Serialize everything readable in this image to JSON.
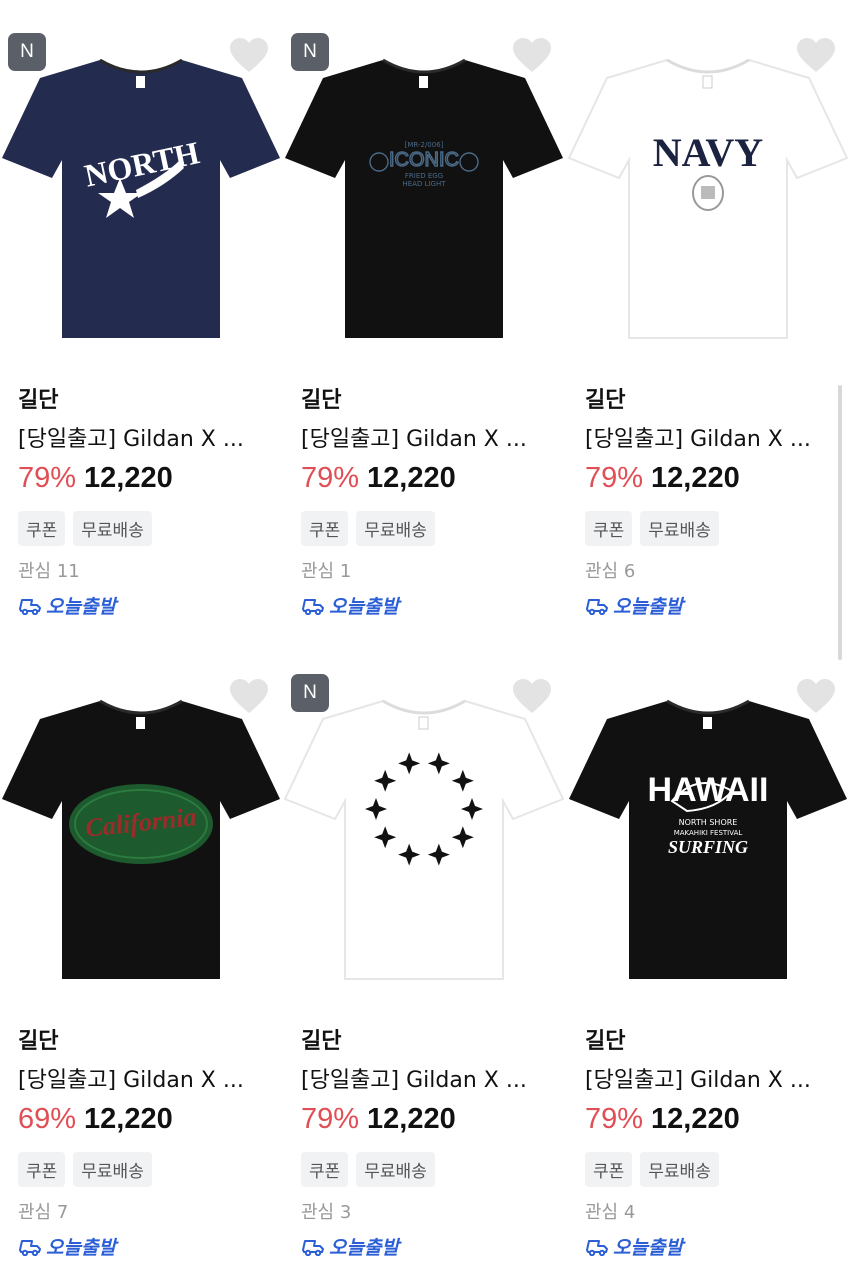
{
  "products": [
    {
      "brand": "길단",
      "title": "[당일출고] Gildan X ...",
      "discount": "79%",
      "price": "12,220",
      "tags": [
        "쿠폰",
        "무료배송"
      ],
      "interest": "관심 11",
      "shipping": "오늘출발",
      "is_new": true,
      "new_label": "N",
      "shirt_color": "#232b4f",
      "graphic": "NORTH",
      "graphic_color": "#ffffff"
    },
    {
      "brand": "길단",
      "title": "[당일출고] Gildan X ...",
      "discount": "79%",
      "price": "12,220",
      "tags": [
        "쿠폰",
        "무료배송"
      ],
      "interest": "관심 1",
      "shipping": "오늘출발",
      "is_new": true,
      "new_label": "N",
      "shirt_color": "#111111",
      "graphic": "ICONIC",
      "graphic_color": "#4a6a88"
    },
    {
      "brand": "길단",
      "title": "[당일출고] Gildan X ...",
      "discount": "79%",
      "price": "12,220",
      "tags": [
        "쿠폰",
        "무료배송"
      ],
      "interest": "관심 6",
      "shipping": "오늘출발",
      "is_new": false,
      "new_label": "",
      "shirt_color": "#ffffff",
      "graphic": "NAVY",
      "graphic_color": "#1c2340"
    },
    {
      "brand": "길단",
      "title": "[당일출고] Gildan X ...",
      "discount": "69%",
      "price": "12,220",
      "tags": [
        "쿠폰",
        "무료배송"
      ],
      "interest": "관심 7",
      "shipping": "오늘출발",
      "is_new": false,
      "new_label": "",
      "shirt_color": "#111111",
      "graphic": "California",
      "graphic_color": "#9c2b2b"
    },
    {
      "brand": "길단",
      "title": "[당일출고] Gildan X ...",
      "discount": "79%",
      "price": "12,220",
      "tags": [
        "쿠폰",
        "무료배송"
      ],
      "interest": "관심 3",
      "shipping": "오늘출발",
      "is_new": true,
      "new_label": "N",
      "shirt_color": "#ffffff",
      "graphic": "stars",
      "graphic_color": "#111111"
    },
    {
      "brand": "길단",
      "title": "[당일출고] Gildan X ...",
      "discount": "79%",
      "price": "12,220",
      "tags": [
        "쿠폰",
        "무료배송"
      ],
      "interest": "관심 4",
      "shipping": "오늘출발",
      "is_new": false,
      "new_label": "",
      "shirt_color": "#111111",
      "graphic": "HAWAII",
      "graphic_color": "#ffffff"
    }
  ],
  "colors": {
    "discount": "#e04e56",
    "shipping": "#2c5fd6",
    "badge": "#5b6068",
    "heart": "#e3e3e3"
  }
}
